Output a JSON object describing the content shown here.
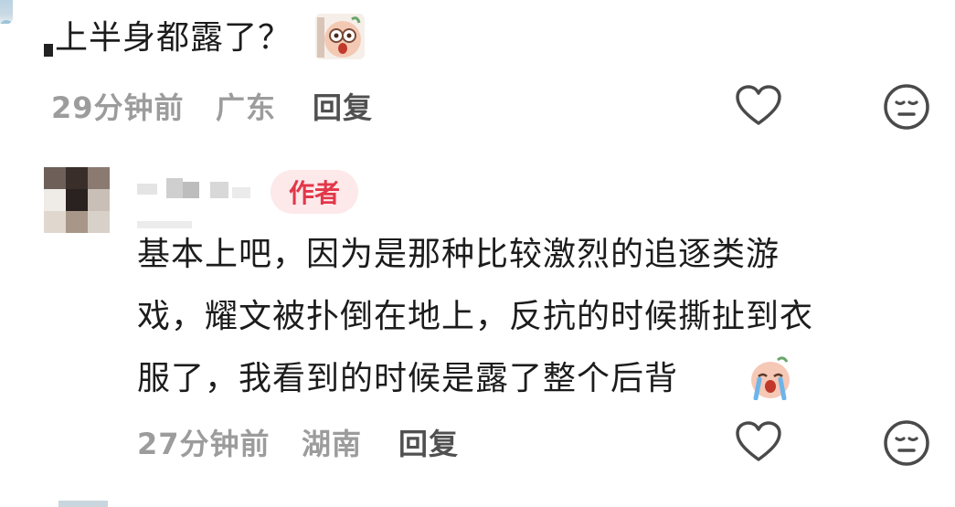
{
  "comments": [
    {
      "text": "上半身都露了？",
      "time": "29分钟前",
      "location": "广东",
      "reply_label": "回复",
      "sticker": "surprised-sticker"
    },
    {
      "author_badge": "作者",
      "lines": [
        "基本上吧，因为是那种比较激烈的追逐类游",
        "戏，耀文被扑倒在地上，反抗的时候撕扯到衣",
        "服了，我看到的时候是露了整个后背"
      ],
      "time": "27分钟前",
      "location": "湖南",
      "reply_label": "回复",
      "sticker": "crying-sticker"
    }
  ],
  "icons": {
    "like": "heart-outline-icon",
    "dislike": "meh-face-icon"
  },
  "colors": {
    "author_badge_bg": "#fde8ea",
    "author_badge_text": "#e2374a",
    "meta_text": "#9c9c9c"
  }
}
